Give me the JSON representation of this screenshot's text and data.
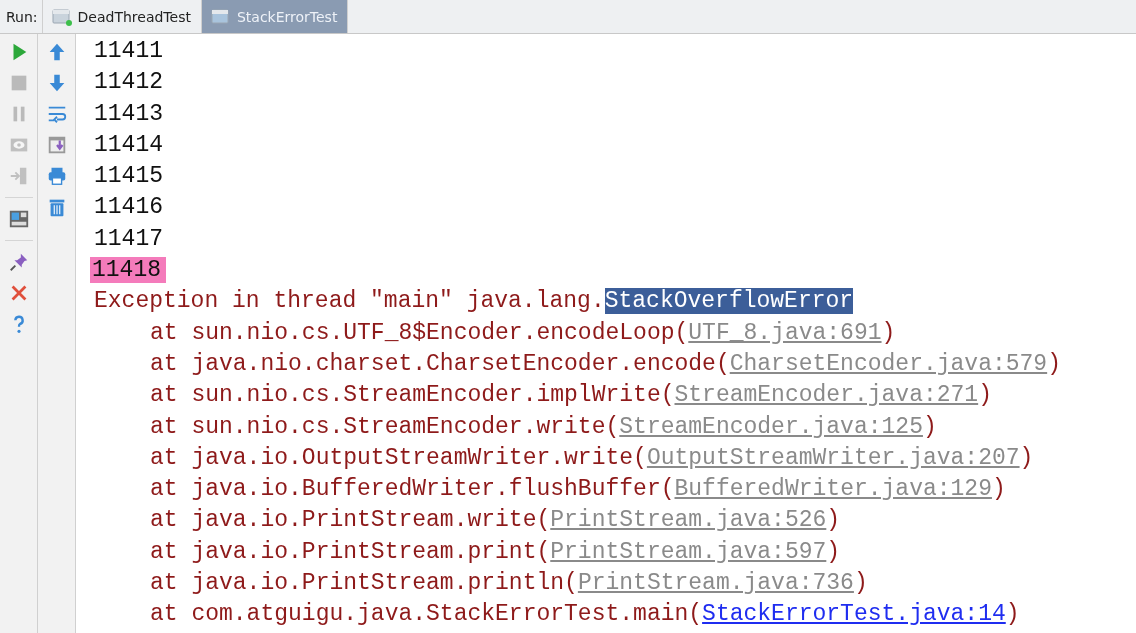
{
  "run_bar": {
    "label": "Run:",
    "tabs": [
      {
        "label": "DeadThreadTest",
        "selected": false
      },
      {
        "label": "StackErrorTest",
        "selected": true
      }
    ]
  },
  "left_toolbar": [
    {
      "kind": "run",
      "disabled": false
    },
    {
      "kind": "stop",
      "disabled": true
    },
    {
      "kind": "pause",
      "disabled": true
    },
    {
      "kind": "eye",
      "disabled": true
    },
    {
      "kind": "exit",
      "disabled": true
    },
    {
      "kind": "separator"
    },
    {
      "kind": "layout",
      "disabled": false
    },
    {
      "kind": "separator"
    },
    {
      "kind": "pin",
      "disabled": false
    },
    {
      "kind": "close",
      "disabled": false
    },
    {
      "kind": "help",
      "disabled": false
    }
  ],
  "right_toolbar": [
    {
      "kind": "up",
      "disabled": false
    },
    {
      "kind": "down",
      "disabled": false
    },
    {
      "kind": "wrap",
      "disabled": false
    },
    {
      "kind": "scroll-end",
      "disabled": false
    },
    {
      "kind": "print",
      "disabled": false
    },
    {
      "kind": "trash",
      "disabled": false
    }
  ],
  "console": {
    "lines": [
      {
        "kind": "output",
        "text": "11411",
        "highlighted": false
      },
      {
        "kind": "output",
        "text": "11412",
        "highlighted": false
      },
      {
        "kind": "output",
        "text": "11413",
        "highlighted": false
      },
      {
        "kind": "output",
        "text": "11414",
        "highlighted": false
      },
      {
        "kind": "output",
        "text": "11415",
        "highlighted": false
      },
      {
        "kind": "output",
        "text": "11416",
        "highlighted": false
      },
      {
        "kind": "output",
        "text": "11417",
        "highlighted": false
      },
      {
        "kind": "output",
        "text": "11418",
        "highlighted": true
      },
      {
        "kind": "exception",
        "text": "Exception in thread \"main\" java.lang.",
        "selected_text": "StackOverflowError"
      },
      {
        "kind": "frame",
        "text": "at sun.nio.cs.UTF_8$Encoder.encodeLoop(",
        "link": "UTF_8.java:691",
        "suffix": ")",
        "in_project": false
      },
      {
        "kind": "frame",
        "text": "at java.nio.charset.CharsetEncoder.encode(",
        "link": "CharsetEncoder.java:579",
        "suffix": ")",
        "in_project": false
      },
      {
        "kind": "frame",
        "text": "at sun.nio.cs.StreamEncoder.implWrite(",
        "link": "StreamEncoder.java:271",
        "suffix": ")",
        "in_project": false
      },
      {
        "kind": "frame",
        "text": "at sun.nio.cs.StreamEncoder.write(",
        "link": "StreamEncoder.java:125",
        "suffix": ")",
        "in_project": false
      },
      {
        "kind": "frame",
        "text": "at java.io.OutputStreamWriter.write(",
        "link": "OutputStreamWriter.java:207",
        "suffix": ")",
        "in_project": false
      },
      {
        "kind": "frame",
        "text": "at java.io.BufferedWriter.flushBuffer(",
        "link": "BufferedWriter.java:129",
        "suffix": ")",
        "in_project": false
      },
      {
        "kind": "frame",
        "text": "at java.io.PrintStream.write(",
        "link": "PrintStream.java:526",
        "suffix": ")",
        "in_project": false
      },
      {
        "kind": "frame",
        "text": "at java.io.PrintStream.print(",
        "link": "PrintStream.java:597",
        "suffix": ")",
        "in_project": false
      },
      {
        "kind": "frame",
        "text": "at java.io.PrintStream.println(",
        "link": "PrintStream.java:736",
        "suffix": ")",
        "in_project": false
      },
      {
        "kind": "frame",
        "text": "at com.atguigu.java.StackErrorTest.main(",
        "link": "StackErrorTest.java:14",
        "suffix": ")",
        "in_project": true
      }
    ]
  }
}
